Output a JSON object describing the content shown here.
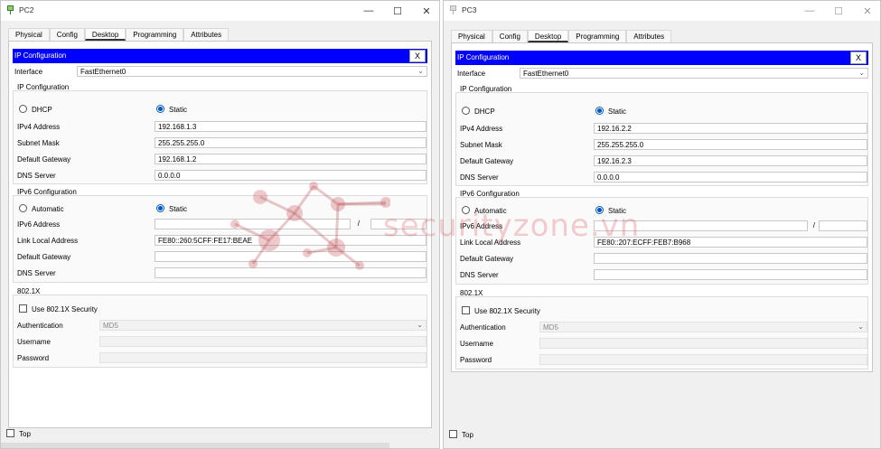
{
  "windows": [
    {
      "title": "PC2",
      "tabs": [
        "Physical",
        "Config",
        "Desktop",
        "Programming",
        "Attributes"
      ],
      "active_tab": "Desktop",
      "ip_config": {
        "header": "IP Configuration",
        "close_label": "X",
        "interface_label": "Interface",
        "interface_value": "FastEthernet0",
        "ipv4_section": "IP Configuration",
        "dhcp_label": "DHCP",
        "static_label": "Static",
        "mode": "static",
        "ipv4_address_label": "IPv4 Address",
        "ipv4_address": "192.168.1.3",
        "subnet_mask_label": "Subnet Mask",
        "subnet_mask": "255.255.255.0",
        "default_gateway_label": "Default Gateway",
        "default_gateway": "192.168.1.2",
        "dns_server_label": "DNS Server",
        "dns_server": "0.0.0.0",
        "ipv6_section": "IPv6 Configuration",
        "automatic_label": "Automatic",
        "ipv6_static_label": "Static",
        "ipv6_mode": "static",
        "ipv6_address_label": "IPv6 Address",
        "ipv6_address": "",
        "ipv6_prefix": "",
        "slash": "/",
        "link_local_label": "Link Local Address",
        "link_local": "FE80::260:5CFF:FE17:BEAE",
        "ipv6_gateway_label": "Default Gateway",
        "ipv6_gateway": "",
        "ipv6_dns_label": "DNS Server",
        "ipv6_dns": "",
        "dot1x_section": "802.1X",
        "use_dot1x_label": "Use 802.1X Security",
        "auth_label": "Authentication",
        "auth_value": "MD5",
        "username_label": "Username",
        "password_label": "Password"
      },
      "top_label": "Top"
    },
    {
      "title": "PC3",
      "tabs": [
        "Physical",
        "Config",
        "Desktop",
        "Programming",
        "Attributes"
      ],
      "active_tab": "Desktop",
      "ip_config": {
        "header": "IP Configuration",
        "close_label": "X",
        "interface_label": "Interface",
        "interface_value": "FastEthernet0",
        "ipv4_section": "IP Configuration",
        "dhcp_label": "DHCP",
        "static_label": "Static",
        "mode": "static",
        "ipv4_address_label": "IPv4 Address",
        "ipv4_address": "192.16.2.2",
        "subnet_mask_label": "Subnet Mask",
        "subnet_mask": "255.255.255.0",
        "default_gateway_label": "Default Gateway",
        "default_gateway": "192.16.2.3",
        "dns_server_label": "DNS Server",
        "dns_server": "0.0.0.0",
        "ipv6_section": "IPv6 Configuration",
        "automatic_label": "Automatic",
        "ipv6_static_label": "Static",
        "ipv6_mode": "static",
        "ipv6_address_label": "IPv6 Address",
        "ipv6_address": "",
        "ipv6_prefix": "",
        "slash": "/",
        "link_local_label": "Link Local Address",
        "link_local": "FE80::207:ECFF:FEB7:B968",
        "ipv6_gateway_label": "Default Gateway",
        "ipv6_gateway": "",
        "ipv6_dns_label": "DNS Server",
        "ipv6_dns": "",
        "dot1x_section": "802.1X",
        "use_dot1x_label": "Use 802.1X Security",
        "auth_label": "Authentication",
        "auth_value": "MD5",
        "username_label": "Username",
        "password_label": "Password"
      },
      "top_label": "Top"
    }
  ],
  "window_controls": {
    "minimize": "—",
    "maximize": "☐",
    "close": "✕"
  },
  "watermark": {
    "text": "securityzone.vn",
    "color": "#dc505a"
  },
  "colors": {
    "ip_header_bg": "#0000ff",
    "radio_selected": "#0058c8"
  }
}
